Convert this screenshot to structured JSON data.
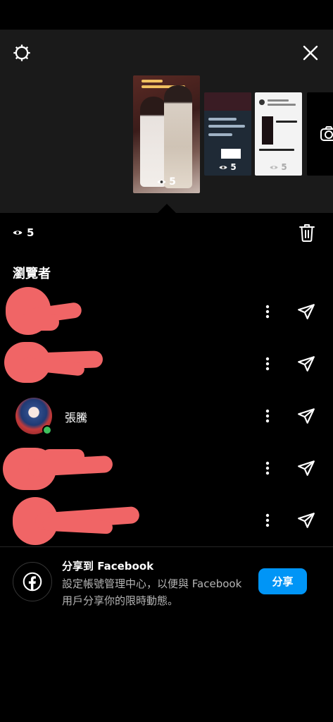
{
  "header": {
    "settings_icon": "settings-gear-icon",
    "close_icon": "close-x-icon"
  },
  "carousel": {
    "stories": [
      {
        "view_count": "5",
        "selected": true
      },
      {
        "view_count": "5",
        "selected": false
      },
      {
        "view_count": "5",
        "selected": false
      },
      {
        "view_count": "",
        "selected": false,
        "type": "camera"
      }
    ]
  },
  "summary": {
    "view_count": "5",
    "eye_icon": "eye-icon",
    "delete_icon": "trash-icon"
  },
  "viewers": {
    "title": "瀏覽者",
    "items": [
      {
        "name": "",
        "redacted": true
      },
      {
        "name": "",
        "redacted": true
      },
      {
        "name": "張騰",
        "redacted": false,
        "online": true
      },
      {
        "name": "",
        "redacted": true
      },
      {
        "name": "",
        "redacted": true
      }
    ],
    "more_icon": "more-vertical-icon",
    "send_icon": "send-paper-plane-icon"
  },
  "facebook_share": {
    "title": "分享到 Facebook",
    "description": "設定帳號管理中心，以便與 Facebook 用戶分享你的限時動態。",
    "button_label": "分享",
    "accent": "#0095f6"
  },
  "colors": {
    "redaction": "#f06566",
    "online": "#3ec15d"
  }
}
